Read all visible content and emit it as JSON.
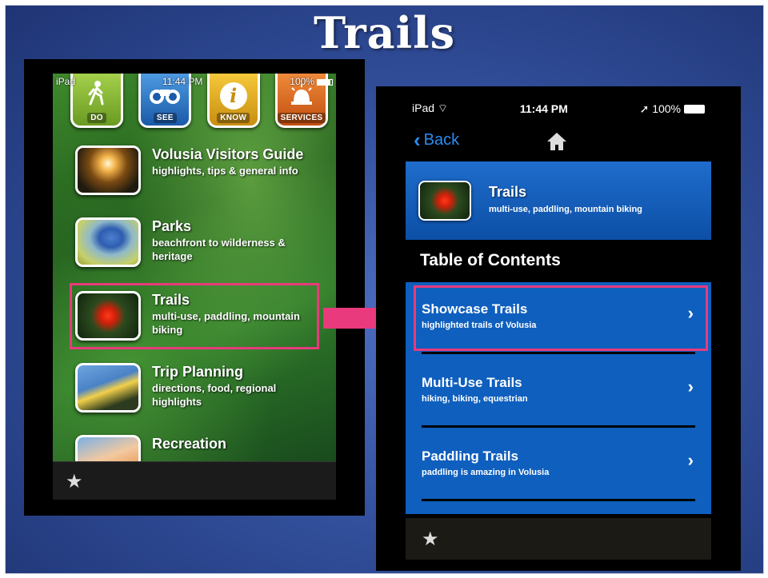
{
  "slide": {
    "title": "Trails"
  },
  "left_device": {
    "status": {
      "carrier": "iPad",
      "time": "11:44 PM",
      "battery": "100%"
    },
    "top_icons": [
      {
        "label": "DO",
        "icon": "hiker-icon"
      },
      {
        "label": "SEE",
        "icon": "binoculars-icon"
      },
      {
        "label": "KNOW",
        "icon": "info-icon"
      },
      {
        "label": "SERVICES",
        "icon": "siren-icon"
      }
    ],
    "menu": [
      {
        "title": "Volusia Visitors Guide",
        "subtitle": "highlights, tips & general info"
      },
      {
        "title": "Parks",
        "subtitle": "beachfront to wilderness & heritage"
      },
      {
        "title": "Trails",
        "subtitle": "multi-use, paddling, mountain biking"
      },
      {
        "title": "Trip Planning",
        "subtitle": "directions, food, regional highlights"
      },
      {
        "title": "Recreation",
        "subtitle": ""
      }
    ],
    "selected_item": "Trails"
  },
  "right_device": {
    "status": {
      "carrier": "iPad",
      "time": "11:44 PM",
      "battery": "100%"
    },
    "nav": {
      "back_label": "Back"
    },
    "header": {
      "title": "Trails",
      "subtitle": "multi-use, paddling, mountain biking"
    },
    "section_title": "Table of Contents",
    "toc": [
      {
        "title": "Showcase Trails",
        "subtitle": "highlighted trails of Volusia"
      },
      {
        "title": "Multi-Use Trails",
        "subtitle": "hiking, biking, equestrian"
      },
      {
        "title": "Paddling Trails",
        "subtitle": "paddling is amazing in Volusia"
      }
    ],
    "selected_item": "Showcase Trails"
  },
  "colors": {
    "highlight": "#e83a7c",
    "ios_blue": "#2c8bf0",
    "list_blue": "#0f5fbe"
  }
}
